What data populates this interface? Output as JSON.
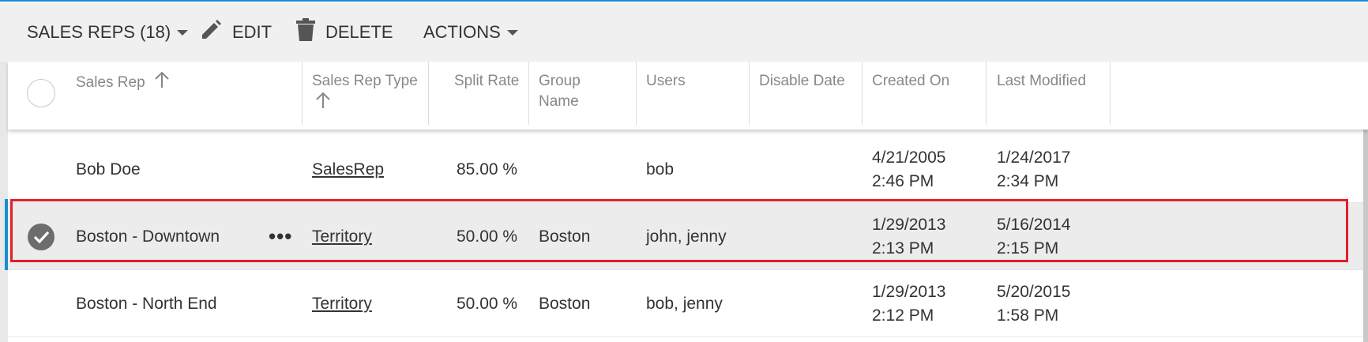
{
  "toolbar": {
    "sales_reps_label": "SALES REPS (18)",
    "edit_label": "EDIT",
    "delete_label": "DELETE",
    "actions_label": "ACTIONS"
  },
  "columns": {
    "sales_rep": "Sales Rep",
    "sales_rep_type": "Sales Rep Type",
    "split_rate": "Split Rate",
    "group_name_1": "Group",
    "group_name_2": "Name",
    "users": "Users",
    "disable_date": "Disable Date",
    "created_on": "Created On",
    "last_modified": "Last Modified"
  },
  "rows": [
    {
      "name": "Bob Doe",
      "type": "SalesRep",
      "split_rate": "85.00 %",
      "group": "",
      "users": "bob",
      "disable_date": "",
      "created_date": "4/21/2005",
      "created_time": "2:46 PM",
      "modified_date": "1/24/2017",
      "modified_time": "2:34 PM"
    },
    {
      "name": "Boston - Downtown",
      "type": "Territory",
      "split_rate": "50.00 %",
      "group": "Boston",
      "users": "john, jenny",
      "disable_date": "",
      "created_date": "1/29/2013",
      "created_time": "2:13 PM",
      "modified_date": "5/16/2014",
      "modified_time": "2:15 PM",
      "more_label": "•••"
    },
    {
      "name": "Boston - North End",
      "type": "Territory",
      "split_rate": "50.00 %",
      "group": "Boston",
      "users": "bob, jenny",
      "disable_date": "",
      "created_date": "1/29/2013",
      "created_time": "2:12 PM",
      "modified_date": "5/20/2015",
      "modified_time": "1:58 PM"
    }
  ],
  "colors": {
    "accent": "#1a8fd0",
    "highlight": "#e0202a",
    "toolbar_bg": "#f0f0f0",
    "selected_row_bg": "#ececec"
  },
  "icons": {
    "edit": "pencil-icon",
    "delete": "trash-icon",
    "sort": "arrow-up-icon",
    "selected": "check-circle-icon",
    "more": "ellipsis-icon"
  }
}
